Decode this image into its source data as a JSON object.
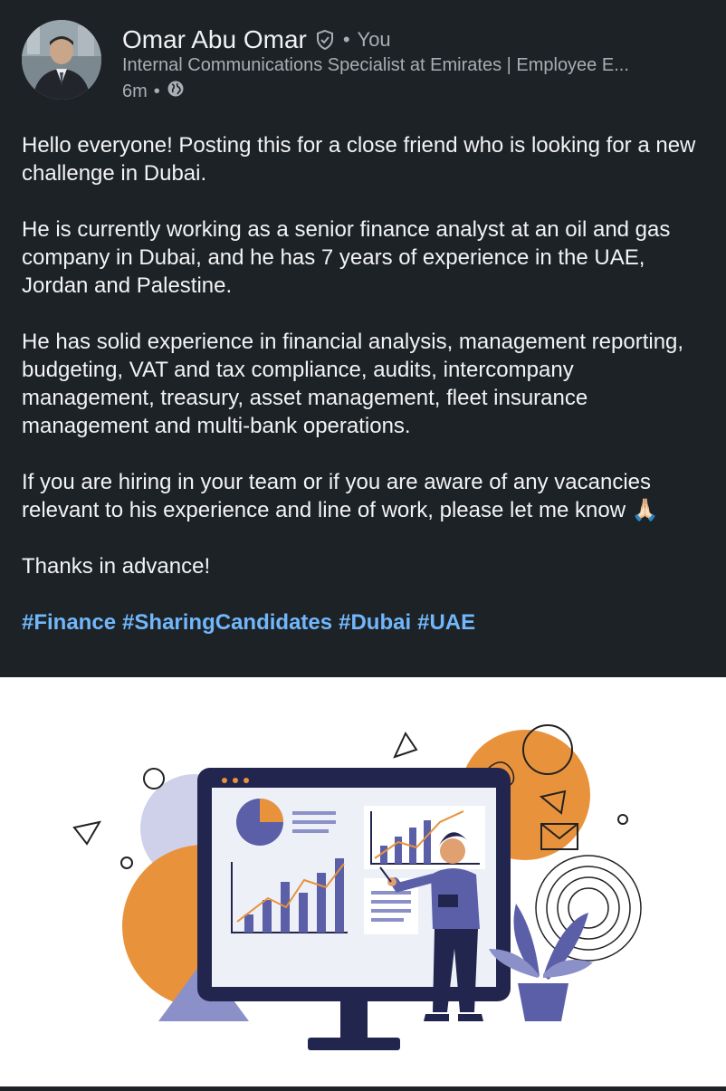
{
  "author": {
    "name": "Omar Abu Omar",
    "you_label": "You",
    "headline": "Internal Communications Specialist at Emirates | Employee E...",
    "time": "6m"
  },
  "post": {
    "paragraphs": [
      "Hello everyone! Posting this for a close friend who is looking for a new challenge in Dubai.",
      "He is currently working as a senior finance analyst at an oil and gas company in Dubai, and he has 7 years of experience in the UAE, Jordan and Palestine.",
      "He has solid experience in financial analysis, management reporting, budgeting, VAT and tax compliance, audits, intercompany management, treasury, asset management, fleet insurance management and multi-bank operations.",
      "If you are hiring in your team or if you are aware of any vacancies relevant to his experience and line of work, please let me know 🙏🏻",
      "Thanks in advance!"
    ],
    "hashtags": [
      "#Finance",
      "#SharingCandidates",
      "#Dubai",
      "#UAE"
    ]
  },
  "icons": {
    "verified": "verified-shield-icon",
    "visibility": "globe-icon"
  },
  "colors": {
    "background": "#1d2226",
    "hashtag": "#71b7fb",
    "accent_orange": "#e8923c",
    "accent_purple": "#5a5fa8",
    "navy": "#1f2550"
  }
}
